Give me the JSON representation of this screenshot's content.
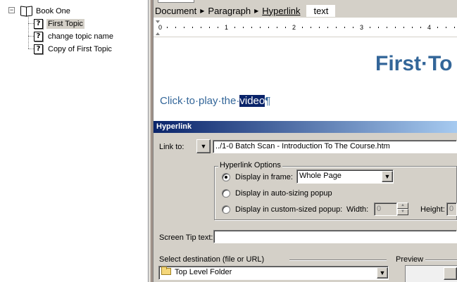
{
  "tree": {
    "root": {
      "label": "Book One",
      "expander": "−"
    },
    "items": [
      {
        "label": "First Topic",
        "icon_glyph": "?",
        "selected": true
      },
      {
        "label": "change topic name",
        "icon_glyph": "?",
        "selected": false
      },
      {
        "label": "Copy of First Topic",
        "icon_glyph": "?",
        "selected": false
      }
    ]
  },
  "breadcrumb": {
    "items": [
      "Document",
      "Paragraph"
    ],
    "link": "Hyperlink",
    "text": "text"
  },
  "ruler": {
    "marks": [
      "0",
      "1",
      "2",
      "3",
      "4"
    ]
  },
  "document": {
    "title": "First·To",
    "para_prefix": "Click·to·play·the·",
    "para_selected": "video",
    "pilcrow": "¶"
  },
  "hyperlink": {
    "title": "Hyperlink",
    "link_to_label": "Link to:",
    "link_to_value": "../1-0 Batch Scan - Introduction To The Course.htm",
    "options_legend": "Hyperlink Options",
    "opt_frame": "Display in frame:",
    "frame_value": "Whole Page",
    "opt_auto": "Display in auto-sizing popup",
    "opt_custom": "Display in custom-sized popup:",
    "width_label": "Width:",
    "width_value": "0",
    "height_label": "Height:",
    "height_value": "0",
    "screen_tip_label": "Screen Tip text:",
    "screen_tip_value": "",
    "dest_label": "Select destination (file or URL)",
    "dest_value": "Top Level Folder",
    "preview_label": "Preview"
  },
  "colors": {
    "heading": "#336699",
    "selection": "#0a246a",
    "titlebar": "#0a246a"
  }
}
